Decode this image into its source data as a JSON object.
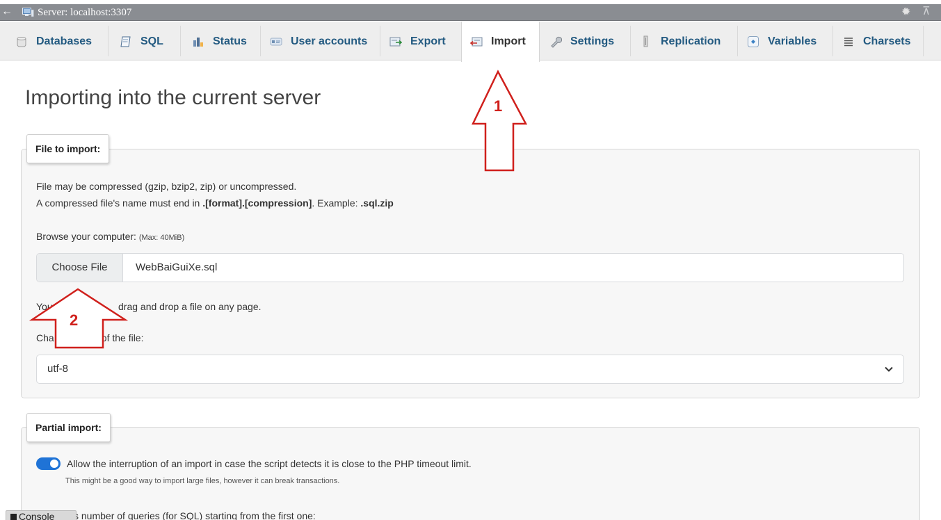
{
  "window": {
    "server_label": "Server: localhost:3307"
  },
  "tabs": [
    {
      "label": "Databases",
      "icon": "database-icon"
    },
    {
      "label": "SQL",
      "icon": "sql-icon"
    },
    {
      "label": "Status",
      "icon": "status-chart-icon"
    },
    {
      "label": "User accounts",
      "icon": "user-accounts-icon"
    },
    {
      "label": "Export",
      "icon": "export-icon"
    },
    {
      "label": "Import",
      "icon": "import-icon",
      "active": true
    },
    {
      "label": "Settings",
      "icon": "wrench-icon"
    },
    {
      "label": "Replication",
      "icon": "replication-icon"
    },
    {
      "label": "Variables",
      "icon": "variables-icon"
    },
    {
      "label": "Charsets",
      "icon": "charsets-icon"
    }
  ],
  "page": {
    "title": "Importing into the current server"
  },
  "file_to_import": {
    "legend": "File to import:",
    "compression_note": "File may be compressed (gzip, bzip2, zip) or uncompressed.",
    "name_note_prefix": "A compressed file's name must end in ",
    "name_note_format": ".[format].[compression]",
    "name_note_mid": ". Example: ",
    "name_note_example": ".sql.zip",
    "browse_label": "Browse your computer: ",
    "browse_max": "(Max: 40MiB)",
    "choose_file_button": "Choose File",
    "chosen_file": "WebBaiGuiXe.sql",
    "drag_drop_note_start": "You",
    "drag_drop_note_end": "drag and drop a file on any page.",
    "charset_label_start": "Cha",
    "charset_label_end": "t of the file:",
    "charset_value": "utf-8"
  },
  "partial_import": {
    "legend": "Partial import:",
    "allow_interrupt_label": "Allow the interruption of an import in case the script detects it is close to the PHP timeout limit.",
    "allow_interrupt_hint": "This might be a good way to import large files, however it can break transactions.",
    "allow_interrupt_enabled": true,
    "skip_queries_label_tail": "s number of queries (for SQL) starting from the first one:"
  },
  "console": {
    "label": "Console"
  },
  "annotations": {
    "arrow_1_label": "1",
    "arrow_2_label": "2",
    "color": "#d0201c"
  },
  "colors": {
    "titlebar_bg": "#8a8d92",
    "tab_link": "#235a81",
    "toggle_on": "#1f73d6"
  }
}
